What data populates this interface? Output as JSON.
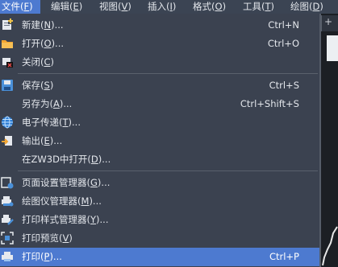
{
  "menubar": [
    {
      "pre": "文件(",
      "key": "F",
      "post": ")",
      "active": true
    },
    {
      "pre": "编辑(",
      "key": "E",
      "post": ")",
      "active": false
    },
    {
      "pre": "视图(",
      "key": "V",
      "post": ")",
      "active": false
    },
    {
      "pre": "插入(",
      "key": "I",
      "post": ")",
      "active": false
    },
    {
      "pre": "格式(",
      "key": "O",
      "post": ")",
      "active": false
    },
    {
      "pre": "工具(",
      "key": "T",
      "post": ")",
      "active": false
    },
    {
      "pre": "绘图(",
      "key": "D",
      "post": ")",
      "active": false
    }
  ],
  "right_strip": {
    "tab_glyph": "+",
    "chevron": "›"
  },
  "file_menu": {
    "items": [
      {
        "pre": "新建(",
        "key": "N",
        "post": ")...",
        "shortcut": "Ctrl+N",
        "icon": "new-file-icon"
      },
      {
        "pre": "打开(",
        "key": "O",
        "post": ")...",
        "shortcut": "Ctrl+O",
        "icon": "open-folder-icon"
      },
      {
        "pre": "关闭(",
        "key": "C",
        "post": ")",
        "shortcut": "",
        "icon": "close-window-icon"
      },
      {
        "pre": "保存(",
        "key": "S",
        "post": ")",
        "shortcut": "Ctrl+S",
        "icon": "save-icon"
      },
      {
        "pre": "另存为(",
        "key": "A",
        "post": ")...",
        "shortcut": "Ctrl+Shift+S",
        "icon": ""
      },
      {
        "pre": "电子传递(",
        "key": "T",
        "post": ")...",
        "shortcut": "",
        "icon": "etransmit-globe-icon"
      },
      {
        "pre": "输出(",
        "key": "E",
        "post": ")...",
        "shortcut": "",
        "icon": "export-icon"
      },
      {
        "pre": "在ZW3D中打开(",
        "key": "D",
        "post": ")...",
        "shortcut": "",
        "icon": ""
      },
      {
        "pre": "页面设置管理器(",
        "key": "G",
        "post": ")...",
        "shortcut": "",
        "icon": "page-setup-icon"
      },
      {
        "pre": "绘图仪管理器(",
        "key": "M",
        "post": ")...",
        "shortcut": "",
        "icon": "plotter-icon"
      },
      {
        "pre": "打印样式管理器(",
        "key": "Y",
        "post": ")...",
        "shortcut": "",
        "icon": "plot-style-icon"
      },
      {
        "pre": "打印预览(",
        "key": "V",
        "post": ")",
        "shortcut": "",
        "icon": "print-preview-icon"
      },
      {
        "pre": "打印(",
        "key": "P",
        "post": ")...",
        "shortcut": "Ctrl+P",
        "icon": "print-icon",
        "highlighted": true
      }
    ]
  },
  "colors": {
    "menu_bg": "#3b4250",
    "highlight": "#4d7ad0",
    "menubar_bg": "#3b4453"
  }
}
